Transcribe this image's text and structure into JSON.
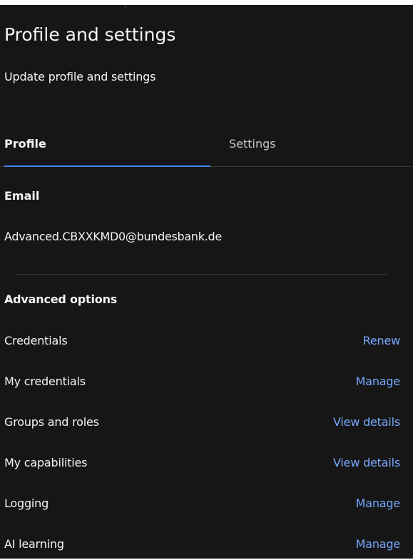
{
  "header": {
    "title": "Profile and settings",
    "subtitle": "Update profile and settings"
  },
  "tabs": [
    {
      "label": "Profile",
      "selected": true
    },
    {
      "label": "Settings",
      "selected": false
    }
  ],
  "profile": {
    "email_label": "Email",
    "email_value": "Advanced.CBXXKMD0@bundesbank.de"
  },
  "advanced": {
    "title": "Advanced options",
    "rows": [
      {
        "label": "Credentials",
        "action": "Renew"
      },
      {
        "label": "My credentials",
        "action": "Manage"
      },
      {
        "label": "Groups and roles",
        "action": "View details"
      },
      {
        "label": "My capabilities",
        "action": "View details"
      },
      {
        "label": "Logging",
        "action": "Manage"
      },
      {
        "label": "AI learning",
        "action": "Manage"
      }
    ]
  },
  "colors": {
    "background": "#161616",
    "text": "#f4f4f4",
    "link": "#78a9ff",
    "tab_indicator": "#4589ff",
    "divider": "#393939"
  }
}
